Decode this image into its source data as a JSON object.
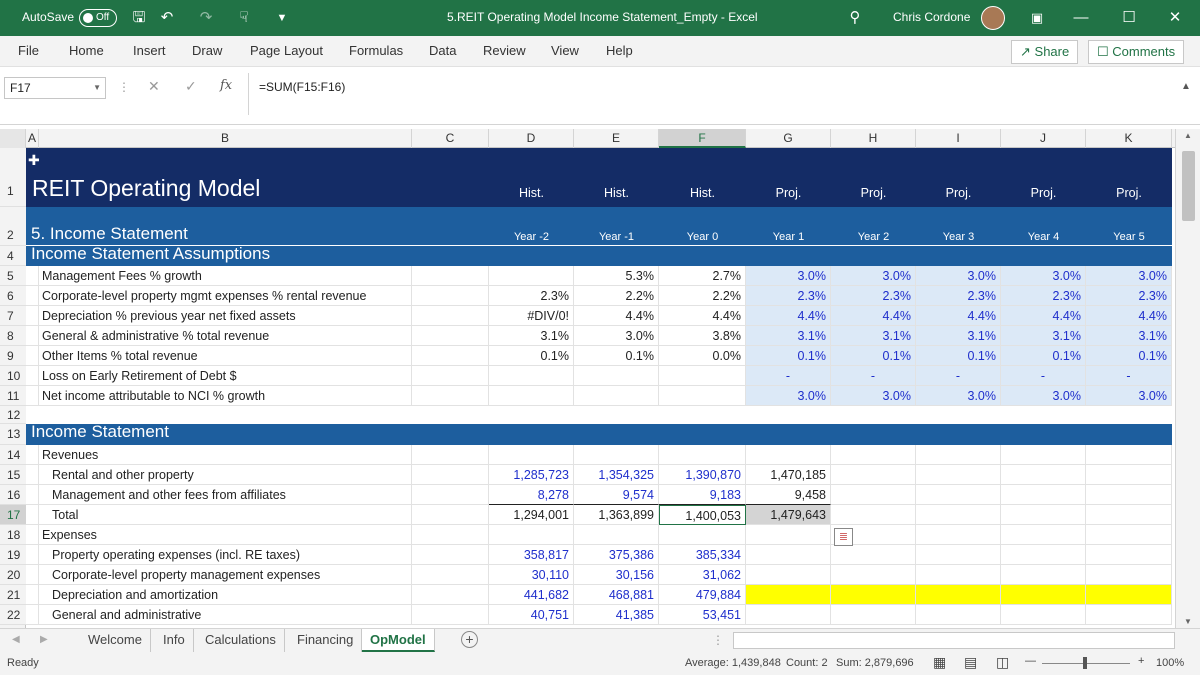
{
  "titlebar": {
    "autosave": "AutoSave",
    "toggle": "Off",
    "title": "5.REIT Operating Model Income Statement_Empty  -  Excel",
    "user": "Chris Cordone"
  },
  "menu": [
    "File",
    "Home",
    "Insert",
    "Draw",
    "Page Layout",
    "Formulas",
    "Data",
    "Review",
    "View",
    "Help"
  ],
  "share_label": "Share",
  "comments_label": "Comments",
  "namebox": "F17",
  "formula": "=SUM(F15:F16)",
  "columns": [
    "A",
    "B",
    "C",
    "D",
    "E",
    "F",
    "G",
    "H",
    "I",
    "J",
    "K"
  ],
  "header": {
    "title": "REIT Operating Model",
    "section": "5. Income Statement",
    "period_types": [
      "Hist.",
      "Hist.",
      "Hist.",
      "Proj.",
      "Proj.",
      "Proj.",
      "Proj.",
      "Proj."
    ],
    "years": [
      "Year -2",
      "Year -1",
      "Year 0",
      "Year 1",
      "Year 2",
      "Year 3",
      "Year 4",
      "Year 5"
    ]
  },
  "assumptions_title": "Income Statement Assumptions",
  "assumptions": [
    {
      "row": "5",
      "label": "Management Fees % growth",
      "v": [
        "",
        "5.3%",
        "2.7%",
        "3.0%",
        "3.0%",
        "3.0%",
        "3.0%",
        "3.0%"
      ]
    },
    {
      "row": "6",
      "label": "Corporate-level property mgmt expenses % rental revenue",
      "v": [
        "2.3%",
        "2.2%",
        "2.2%",
        "2.3%",
        "2.3%",
        "2.3%",
        "2.3%",
        "2.3%"
      ]
    },
    {
      "row": "7",
      "label": "Depreciation % previous year net fixed assets",
      "v": [
        "#DIV/0!",
        "4.4%",
        "4.4%",
        "4.4%",
        "4.4%",
        "4.4%",
        "4.4%",
        "4.4%"
      ]
    },
    {
      "row": "8",
      "label": "General & administrative % total revenue",
      "v": [
        "3.1%",
        "3.0%",
        "3.8%",
        "3.1%",
        "3.1%",
        "3.1%",
        "3.1%",
        "3.1%"
      ]
    },
    {
      "row": "9",
      "label": "Other Items % total revenue",
      "v": [
        "0.1%",
        "0.1%",
        "0.0%",
        "0.1%",
        "0.1%",
        "0.1%",
        "0.1%",
        "0.1%"
      ]
    },
    {
      "row": "10",
      "label": "Loss on Early Retirement of Debt $",
      "v": [
        "",
        "",
        "",
        "-",
        "-",
        "-",
        "-",
        "-"
      ]
    },
    {
      "row": "11",
      "label": "Net income attributable to NCI % growth",
      "v": [
        "",
        "",
        "",
        "3.0%",
        "3.0%",
        "3.0%",
        "3.0%",
        "3.0%"
      ]
    }
  ],
  "blank_row": "12",
  "income_title": "Income Statement",
  "income": [
    {
      "row": "14",
      "label": "Revenues",
      "indent": 0,
      "v": [
        "",
        "",
        "",
        "",
        "",
        "",
        "",
        ""
      ]
    },
    {
      "row": "15",
      "label": "Rental and other property",
      "indent": 1,
      "v": [
        "1,285,723",
        "1,354,325",
        "1,390,870",
        "1,470,185",
        "",
        "",
        "",
        ""
      ]
    },
    {
      "row": "16",
      "label": "Management and other fees from affiliates",
      "indent": 1,
      "v": [
        "8,278",
        "9,574",
        "9,183",
        "9,458",
        "",
        "",
        "",
        ""
      ]
    },
    {
      "row": "17",
      "label": "Total",
      "indent": 1,
      "v": [
        "1,294,001",
        "1,363,899",
        "1,400,053",
        "1,479,643",
        "",
        "",
        "",
        ""
      ]
    },
    {
      "row": "18",
      "label": "Expenses",
      "indent": 0,
      "v": [
        "",
        "",
        "",
        "",
        "",
        "",
        "",
        ""
      ]
    },
    {
      "row": "19",
      "label": "Property operating expenses (incl. RE taxes)",
      "indent": 1,
      "v": [
        "358,817",
        "375,386",
        "385,334",
        "",
        "",
        "",
        "",
        ""
      ]
    },
    {
      "row": "20",
      "label": "Corporate-level property management expenses",
      "indent": 1,
      "v": [
        "30,110",
        "30,156",
        "31,062",
        "",
        "",
        "",
        "",
        ""
      ]
    },
    {
      "row": "21",
      "label": "Depreciation and amortization",
      "indent": 1,
      "v": [
        "441,682",
        "468,881",
        "479,884",
        "",
        "",
        "",
        "",
        ""
      ]
    },
    {
      "row": "22",
      "label": "General and administrative",
      "indent": 1,
      "v": [
        "40,751",
        "41,385",
        "53,451",
        "",
        "",
        "",
        "",
        ""
      ]
    }
  ],
  "sheets": [
    "Welcome",
    "Info",
    "Calculations",
    "Financing",
    "OpModel"
  ],
  "status": {
    "ready": "Ready",
    "average": "Average: 1,439,848",
    "count": "Count: 2",
    "sum": "Sum: 2,879,696",
    "zoom": "100%"
  },
  "colors": {
    "excel_green": "#217346",
    "header_navy": "#142c66",
    "section_blue": "#1d5e9e",
    "input_blue": "#1f2fcc",
    "projection_fill": "#dce9f7",
    "highlight_yellow": "#ffff00"
  }
}
